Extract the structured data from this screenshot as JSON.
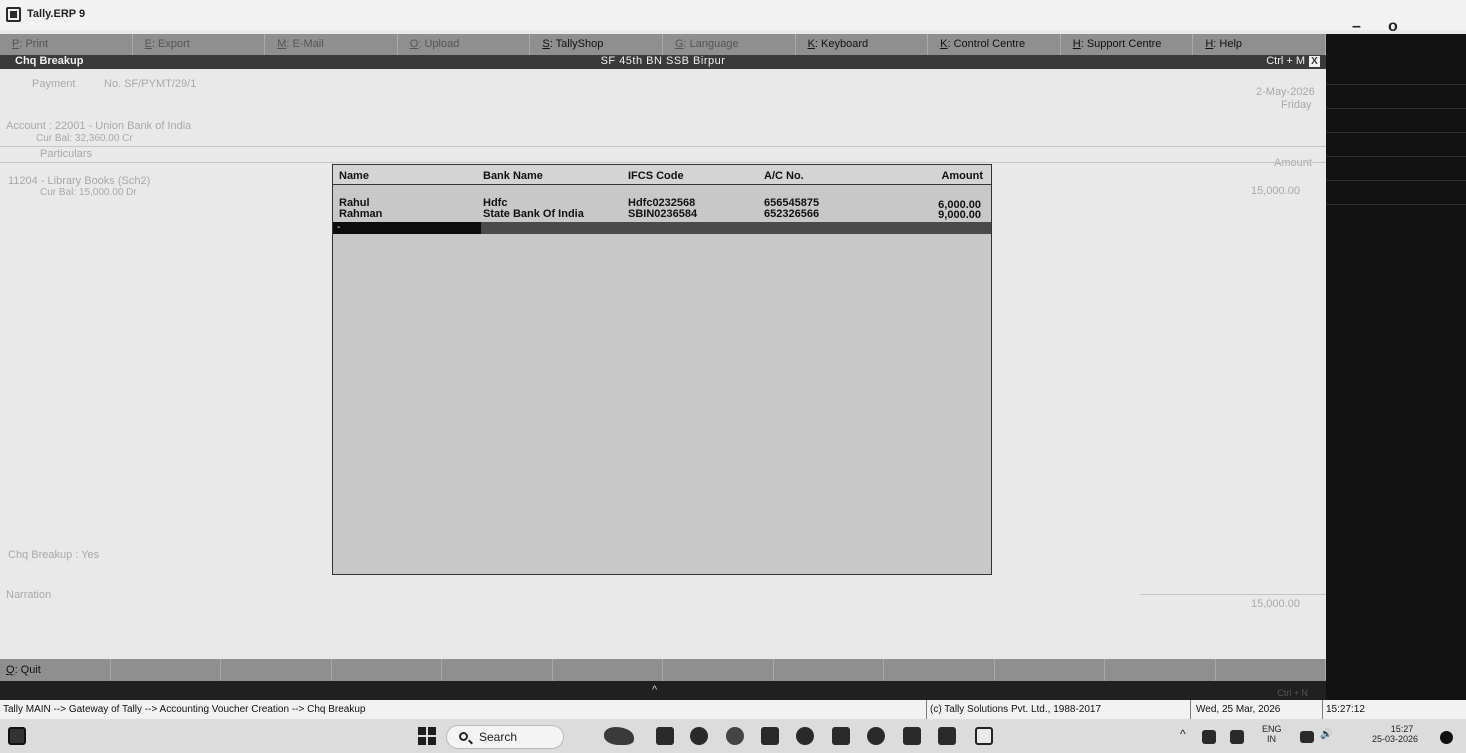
{
  "window": {
    "title": "Tally.ERP 9",
    "minimize": "–",
    "maximize": "o"
  },
  "function_bar": [
    {
      "key": "P",
      "label": ": Print",
      "dim": true
    },
    {
      "key": "E",
      "label": ": Export",
      "dim": true
    },
    {
      "key": "M",
      "label": ": E-Mail",
      "dim": true
    },
    {
      "key": "O",
      "label": ": Upload",
      "dim": true
    },
    {
      "key": "S",
      "label": ": TallyShop",
      "dim": false
    },
    {
      "key": "G",
      "label": ": Language",
      "dim": true
    },
    {
      "key": "K",
      "label": ": Keyboard",
      "dim": false
    },
    {
      "key": "K",
      "label": ": Control Centre",
      "dim": false
    },
    {
      "key": "H",
      "label": ": Support Centre",
      "dim": false
    },
    {
      "key": "H",
      "label": ": Help",
      "dim": false
    }
  ],
  "screen": {
    "title": "Chq Breakup",
    "company": "SF 45th BN SSB Birpur",
    "shortcut": "Ctrl + M",
    "close": "X"
  },
  "voucher": {
    "type": "Payment",
    "number": "No. SF/PYMT/29/1",
    "date": "2-May-2026",
    "day": "Friday",
    "account": "Account : 22001 - Union Bank of India",
    "cur_bal": "Cur Bal: 32,360.00 Cr",
    "particulars_label": "Particulars",
    "amount_label": "Amount",
    "ledger": "11204 - Library Books (Sch2)",
    "ledger_bal": "Cur Bal: 15,000.00 Dr",
    "line_amount": "15,000.00",
    "chq_breakup": "Chq Breakup : Yes",
    "narration_label": "Narration",
    "total": "15,000.00"
  },
  "popup": {
    "headers": {
      "name": "Name",
      "bank": "Bank Name",
      "ifsc": "IFCS Code",
      "ac": "A/C No.",
      "amount": "Amount"
    },
    "rows": [
      {
        "name": "Rahul",
        "bank": "Hdfc",
        "ifsc": "Hdfc0232568",
        "ac": "656545875",
        "amount": "6,000.00"
      },
      {
        "name": "Rahman",
        "bank": "State Bank Of India",
        "ifsc": "SBIN0236584",
        "ac": "652326566",
        "amount": "9,000.00"
      }
    ],
    "cursor_text": "-"
  },
  "bottom_bar": {
    "quit_key": "Q",
    "quit_label": ": Quit",
    "ctrl_hint": "Ctrl + N"
  },
  "status": {
    "path": "Tally MAIN --> Gateway of Tally --> Accounting Voucher Creation --> Chq Breakup",
    "copyright": "(c) Tally Solutions Pvt. Ltd., 1988-2017",
    "date": "Wed, 25 Mar, 2026",
    "time": "15:27:12"
  },
  "taskbar": {
    "search_label": "Search",
    "lang": "ENG",
    "region": "IN",
    "clock_time": "15:27",
    "clock_date": "25-03-2026"
  },
  "colors": {
    "fnbar": "#8f8f8f",
    "screenbar": "#3a3a3a",
    "popup_bg": "#c8c8c8",
    "right_panel": "#121212"
  }
}
